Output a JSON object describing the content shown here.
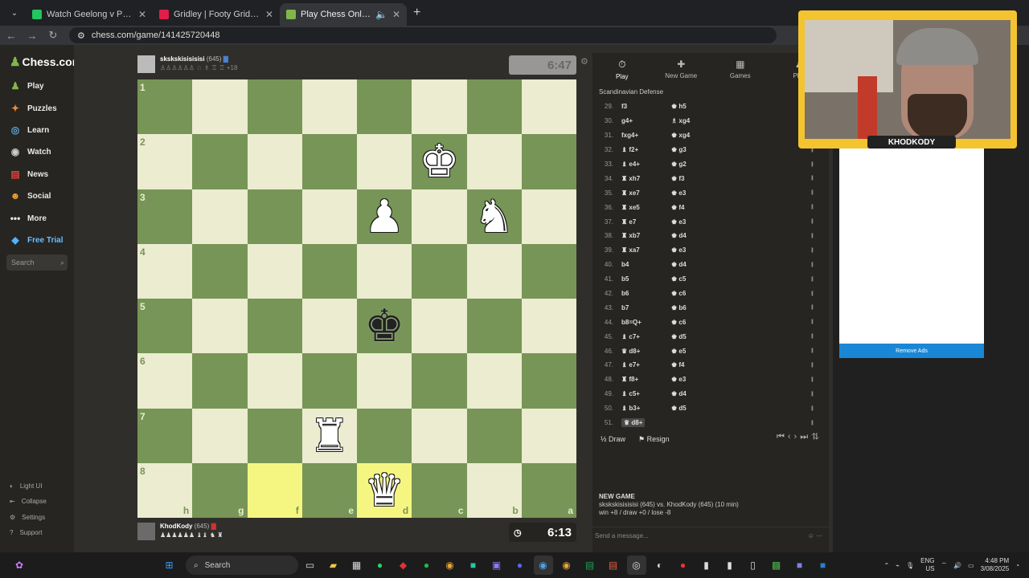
{
  "browser": {
    "tabs": [
      {
        "title": "Watch Geelong v Port Adelaide",
        "color": "#22c55e"
      },
      {
        "title": "Gridley | Footy Grid Game for A",
        "color": "#e11d48"
      },
      {
        "title": "Play Chess Online for FREE",
        "color": "#81b64c",
        "active": true
      }
    ],
    "url": "chess.com/game/141425720448"
  },
  "sidebar": {
    "logo": "Chess.com",
    "logo_badge": "2",
    "items": [
      {
        "label": "Play",
        "icon": "play-icon"
      },
      {
        "label": "Puzzles",
        "icon": "puzzle-icon"
      },
      {
        "label": "Learn",
        "icon": "learn-icon"
      },
      {
        "label": "Watch",
        "icon": "watch-icon"
      },
      {
        "label": "News",
        "icon": "news-icon"
      },
      {
        "label": "Social",
        "icon": "social-icon"
      },
      {
        "label": "More",
        "icon": "more-icon"
      },
      {
        "label": "Free Trial",
        "icon": "diamond-icon"
      }
    ],
    "search_placeholder": "Search",
    "bottom": [
      {
        "label": "Light UI"
      },
      {
        "label": "Collapse"
      },
      {
        "label": "Settings"
      },
      {
        "label": "Support"
      }
    ]
  },
  "opponent": {
    "name": "skskskisisisisi",
    "rating": "(645)",
    "captured": "+18",
    "clock": "6:47"
  },
  "player": {
    "name": "KhodKody",
    "rating": "(645)",
    "clock": "6:13"
  },
  "board": {
    "ranks": [
      "1",
      "2",
      "3",
      "4",
      "5",
      "6",
      "7",
      "8"
    ],
    "files": [
      "h",
      "g",
      "f",
      "e",
      "d",
      "c",
      "b",
      "a"
    ],
    "highlight": [
      [
        7,
        2
      ],
      [
        7,
        4
      ]
    ],
    "pieces": [
      {
        "row": 1,
        "col": 5,
        "glyph": "♚",
        "side": "white",
        "name": "white-king-icon"
      },
      {
        "row": 2,
        "col": 4,
        "glyph": "♟",
        "side": "white",
        "name": "white-pawn-icon"
      },
      {
        "row": 2,
        "col": 6,
        "glyph": "♞",
        "side": "white",
        "name": "white-knight-icon"
      },
      {
        "row": 4,
        "col": 4,
        "glyph": "♚",
        "side": "black",
        "name": "black-king-icon"
      },
      {
        "row": 6,
        "col": 3,
        "glyph": "♜",
        "side": "white",
        "name": "white-rook-icon"
      },
      {
        "row": 7,
        "col": 4,
        "glyph": "♛",
        "side": "white",
        "name": "white-queen-icon"
      }
    ]
  },
  "panel": {
    "tabs": [
      {
        "label": "Play",
        "icon": "⏱"
      },
      {
        "label": "New Game",
        "icon": "✚"
      },
      {
        "label": "Games",
        "icon": "▦"
      },
      {
        "label": "Play",
        "icon": "♟"
      }
    ],
    "opening": "Scandinavian Defense",
    "moves": [
      {
        "n": "29.",
        "w": "f3",
        "b": "♚ h5"
      },
      {
        "n": "30.",
        "w": "g4+",
        "b": "♗ xg4"
      },
      {
        "n": "31.",
        "w": "fxg4+",
        "b": "♚ xg4"
      },
      {
        "n": "32.",
        "w": "♝ f2+",
        "b": "♚ g3"
      },
      {
        "n": "33.",
        "w": "♝ e4+",
        "b": "♚ g2"
      },
      {
        "n": "34.",
        "w": "♜ xh7",
        "b": "♚ f3"
      },
      {
        "n": "35.",
        "w": "♜ xe7",
        "b": "♚ e3"
      },
      {
        "n": "36.",
        "w": "♜ xe5",
        "b": "♚ f4"
      },
      {
        "n": "37.",
        "w": "♜ e7",
        "b": "♚ e3"
      },
      {
        "n": "38.",
        "w": "♜ xb7",
        "b": "♚ d4"
      },
      {
        "n": "39.",
        "w": "♜ xa7",
        "b": "♚ e3"
      },
      {
        "n": "40.",
        "w": "b4",
        "b": "♚ d4"
      },
      {
        "n": "41.",
        "w": "b5",
        "b": "♚ c5"
      },
      {
        "n": "42.",
        "w": "b6",
        "b": "♚ c6"
      },
      {
        "n": "43.",
        "w": "b7",
        "b": "♚ b6"
      },
      {
        "n": "44.",
        "w": "b8=Q+",
        "b": "♚ c6"
      },
      {
        "n": "45.",
        "w": "♝ c7+",
        "b": "♚ d5"
      },
      {
        "n": "46.",
        "w": "♛ d8+",
        "b": "♚ e5"
      },
      {
        "n": "47.",
        "w": "♝ e7+",
        "b": "♚ f4"
      },
      {
        "n": "48.",
        "w": "♜ f8+",
        "b": "♚ e3"
      },
      {
        "n": "49.",
        "w": "♝ c5+",
        "b": "♚ d4"
      },
      {
        "n": "50.",
        "w": "♝ b3+",
        "b": "♚ d5"
      },
      {
        "n": "51.",
        "w": "♛ d8+",
        "b": ""
      }
    ],
    "draw": "Draw",
    "resign": "Resign",
    "new_game_title": "NEW GAME",
    "new_game_line1": "skskskisisisisi (645) vs. KhodKody (645) (10 min)",
    "new_game_line2": "win +8 / draw +0 / lose -8",
    "chat_placeholder": "Send a message..."
  },
  "ad": {
    "button": "Remove Ads"
  },
  "webcam": {
    "name": "KHODKODY"
  },
  "taskbar": {
    "search": "Search",
    "lang1": "ENG",
    "lang2": "US",
    "time": "4:48 PM",
    "date": "3/08/2025"
  }
}
